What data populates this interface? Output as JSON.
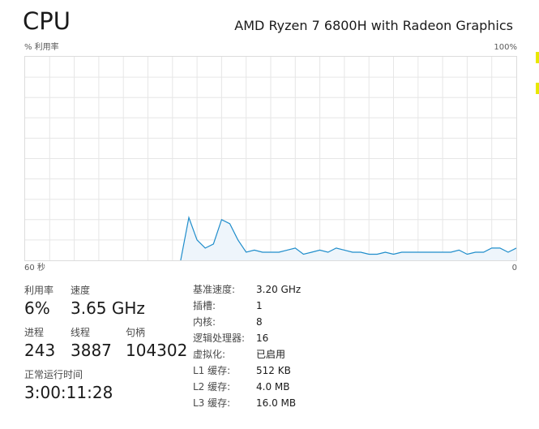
{
  "header": {
    "title": "CPU",
    "cpu_model": "AMD Ryzen 7 6800H with Radeon Graphics"
  },
  "graph": {
    "y_label": "% 利用率",
    "y_max_label": "100%",
    "x_left_label": "60 秒",
    "x_right_label": "0",
    "line_color": "#1f8dcb",
    "fill_color": "#eef5fb",
    "grid_color": "#e6e6e6"
  },
  "chart_data": {
    "type": "area",
    "ylabel": "% 利用率",
    "ylim": [
      0,
      100
    ],
    "xlabel": "",
    "x_range": [
      60,
      0
    ],
    "grid": true,
    "series": [
      {
        "values": [
          0,
          0,
          0,
          0,
          0,
          0,
          0,
          0,
          0,
          0,
          0,
          0,
          0,
          0,
          0,
          0,
          0,
          0,
          0,
          0,
          21,
          10,
          6,
          8,
          20,
          18,
          10,
          4,
          5,
          4,
          4,
          4,
          5,
          6,
          3,
          4,
          5,
          4,
          6,
          5,
          4,
          4,
          3,
          3,
          4,
          3,
          4,
          4,
          4,
          4,
          4,
          4,
          4,
          5,
          3,
          4,
          4,
          6,
          6,
          4,
          6
        ]
      }
    ]
  },
  "stats": {
    "utilization": {
      "label": "利用率",
      "value": "6%"
    },
    "speed": {
      "label": "速度",
      "value": "3.65 GHz"
    },
    "processes": {
      "label": "进程",
      "value": "243"
    },
    "threads": {
      "label": "线程",
      "value": "3887"
    },
    "handles": {
      "label": "句柄",
      "value": "104302"
    },
    "uptime": {
      "label": "正常运行时间",
      "value": "3:00:11:28"
    }
  },
  "details": [
    {
      "key": "基准速度:",
      "value": "3.20 GHz"
    },
    {
      "key": "插槽:",
      "value": "1"
    },
    {
      "key": "内核:",
      "value": "8"
    },
    {
      "key": "逻辑处理器:",
      "value": "16"
    },
    {
      "key": "虚拟化:",
      "value": "已启用"
    },
    {
      "key": "L1 缓存:",
      "value": "512 KB"
    },
    {
      "key": "L2 缓存:",
      "value": "4.0 MB"
    },
    {
      "key": "L3 缓存:",
      "value": "16.0 MB"
    }
  ]
}
